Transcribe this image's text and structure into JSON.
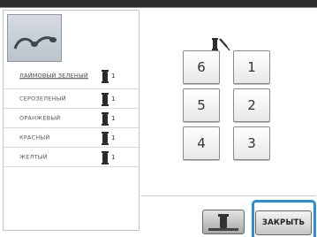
{
  "colors": [
    {
      "name": "ЛАЙМОВЫЙ ЗЕЛЕНЫЙ",
      "count": "1"
    },
    {
      "name": "СЕРОЗЕЛЕНЫЙ",
      "count": "1"
    },
    {
      "name": "ОРАНЖЕВЫЙ",
      "count": "1"
    },
    {
      "name": "КРАСНЫЙ",
      "count": "1"
    },
    {
      "name": "ЖЕЛТЫЙ",
      "count": "1"
    }
  ],
  "needles": [
    "6",
    "1",
    "5",
    "2",
    "4",
    "3"
  ],
  "icons": {
    "preview": "embroidery-preview-icon",
    "spool": "thread-spool-icon",
    "wrench": "needle-wrench-icon"
  },
  "buttons": {
    "close_label": "ЗАКРЫТЬ"
  },
  "accent": "#2c8fd6"
}
